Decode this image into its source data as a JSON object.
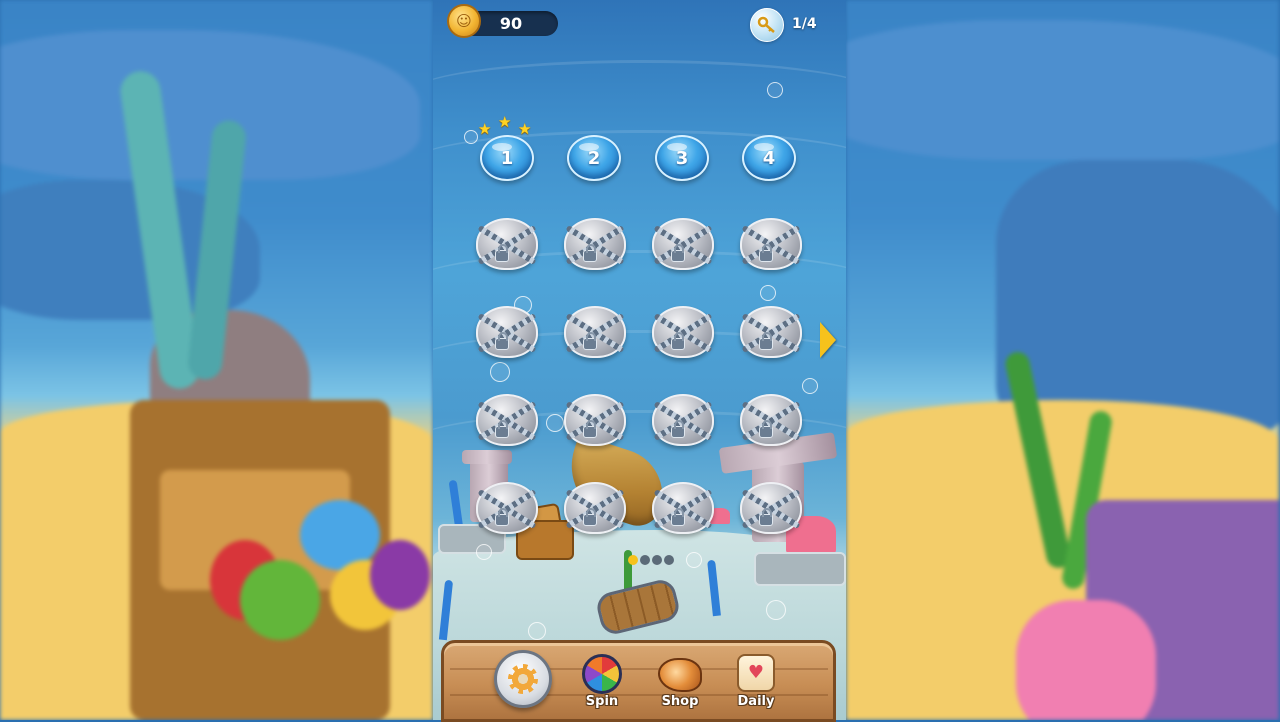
{
  "hud": {
    "coins": "90",
    "coin_icon": "gold-coin-icon",
    "key_icon": "key-bubble-icon",
    "keys": "1/4"
  },
  "levels": {
    "unlocked": [
      {
        "label": "1",
        "stars": 3
      },
      {
        "label": "2",
        "stars": 0
      },
      {
        "label": "3",
        "stars": 0
      },
      {
        "label": "4",
        "stars": 0
      }
    ],
    "locked_count": 16,
    "next_page_icon": "arrow-right-icon"
  },
  "menu": {
    "settings_icon": "gear-icon",
    "spin_label": "Spin",
    "shop_label": "Shop",
    "daily_label": "Daily"
  },
  "colors": {
    "accent_gold": "#f6c21c",
    "bubble_blue": "#3fa6e8",
    "wood": "#c88e55"
  }
}
